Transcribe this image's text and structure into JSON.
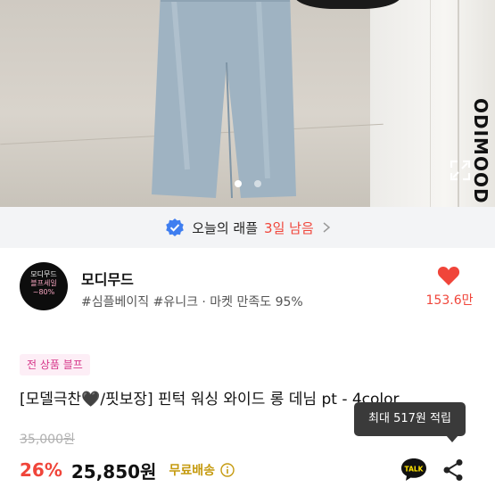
{
  "photo": {
    "watermark": "ODIMOOD",
    "slide_indicator": {
      "count": 2,
      "active": 1
    }
  },
  "raffle": {
    "label": "오늘의 래플",
    "days": "3일 남음"
  },
  "shop": {
    "logo_lines": [
      "모디무드",
      "블프세일",
      "~80%"
    ],
    "name": "모디무드",
    "meta": "#심플베이직 #유니크 · 마켓 만족도 95%",
    "likes": "153.6만"
  },
  "product": {
    "badge": "전 상품 블프",
    "title": "[모델극찬🖤/핏보장] 핀턱 워싱 와이드 롱 데님 pt - 4color",
    "original_price": "35,000원",
    "discount": "26%",
    "price": "25,850원",
    "shipping": "무료배송",
    "tooltip": "최대 517원 적립",
    "talk_label": "TALK"
  },
  "colors": {
    "accent_red": "#f0453a",
    "badge_pink": "#d6378a",
    "shipping_gold": "#c59a0e",
    "verified_blue": "#3f7ef0"
  }
}
